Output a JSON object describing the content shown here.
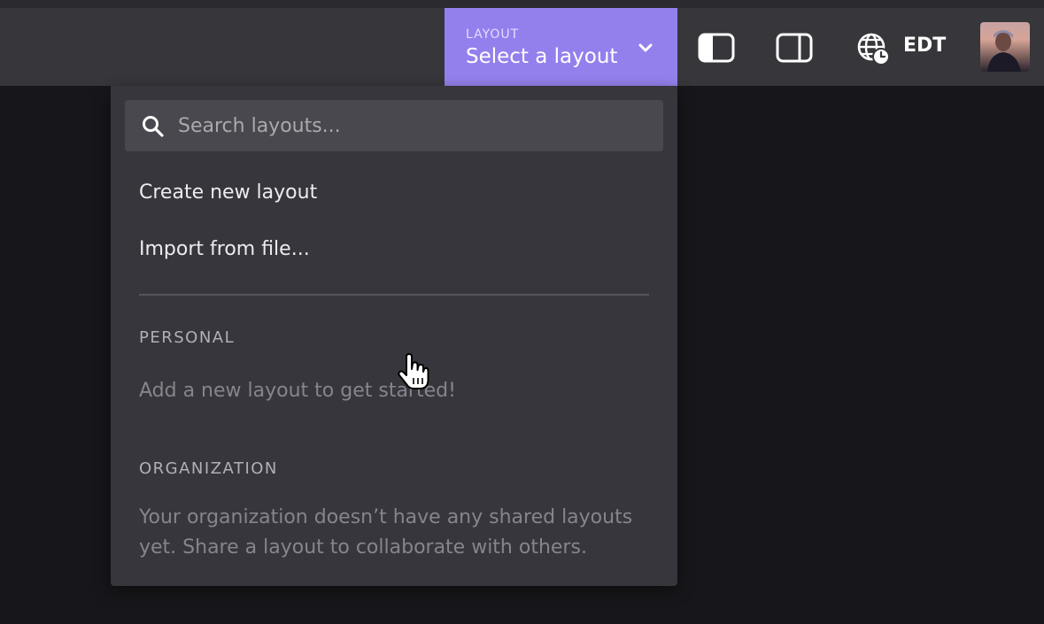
{
  "header": {
    "layout_label": "LAYOUT",
    "layout_value": "Select a layout",
    "timezone": "EDT",
    "icons": [
      "chevron-down-icon",
      "left-sidebar-icon",
      "right-sidebar-icon",
      "globe-clock-icon"
    ],
    "accent_color": "#9480ec"
  },
  "dropdown": {
    "search_placeholder": "Search layouts...",
    "create_label": "Create new layout",
    "import_label": "Import from file...",
    "personal_heading": "PERSONAL",
    "personal_empty": "Add a new layout to get started!",
    "org_heading": "ORGANIZATION",
    "org_empty": "Your organization doesn’t have any shared layouts yet. Share a layout to collaborate with others."
  }
}
